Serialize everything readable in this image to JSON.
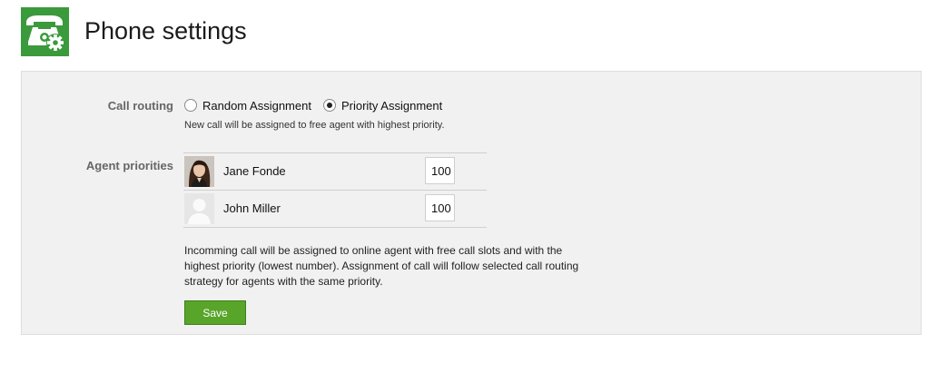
{
  "header": {
    "title": "Phone settings",
    "icon": "phone-settings-icon",
    "icon_color": "#3a9a3c"
  },
  "call_routing": {
    "label": "Call routing",
    "options": [
      {
        "label": "Random Assignment",
        "selected": false
      },
      {
        "label": "Priority Assignment",
        "selected": true
      }
    ],
    "hint": "New call will be assigned to free agent with highest priority."
  },
  "agent_priorities": {
    "label": "Agent priorities",
    "agents": [
      {
        "name": "Jane Fonde",
        "priority": "100",
        "avatar": "photo"
      },
      {
        "name": "John Miller",
        "priority": "100",
        "avatar": "placeholder"
      }
    ],
    "description": "Incomming call will be assigned to online agent with free call slots and with the highest priority (lowest number). Assignment of call will follow selected call routing strategy for agents with the same priority."
  },
  "actions": {
    "save_label": "Save",
    "save_color": "#58a52a"
  }
}
